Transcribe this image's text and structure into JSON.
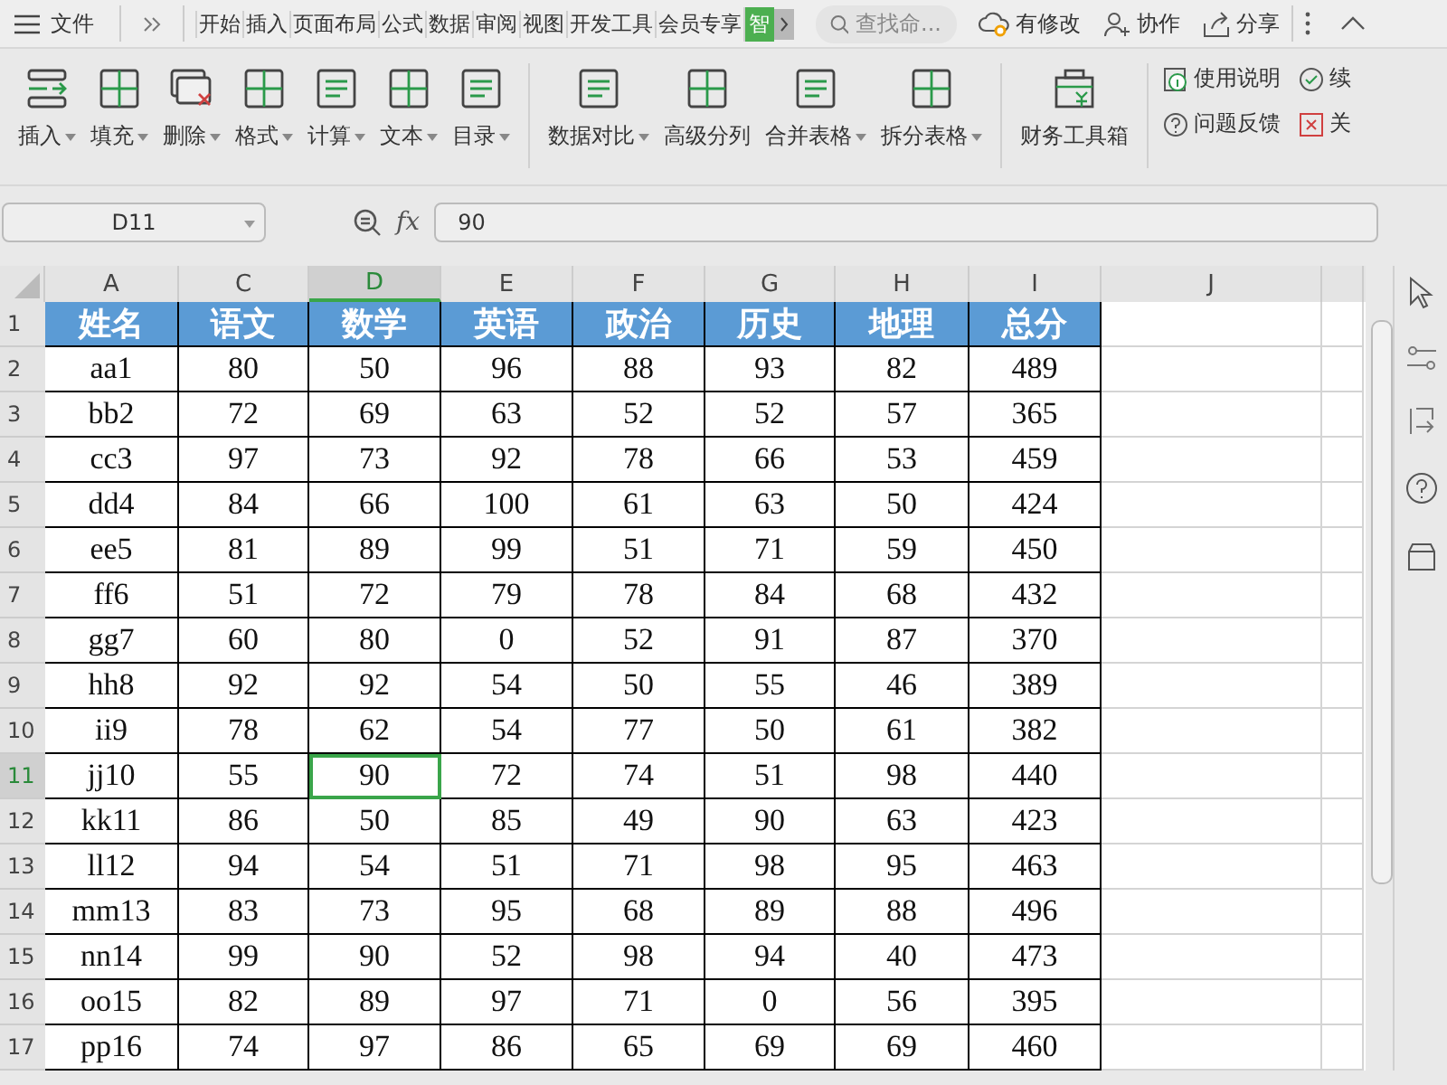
{
  "title_bar": {
    "file_menu": "文件",
    "tabs": [
      {
        "label": "开始",
        "selected": false
      },
      {
        "label": "插入",
        "selected": false
      },
      {
        "label": "页面布局",
        "selected": false
      },
      {
        "label": "公式",
        "selected": false
      },
      {
        "label": "数据",
        "selected": false
      },
      {
        "label": "审阅",
        "selected": false
      },
      {
        "label": "视图",
        "selected": false
      },
      {
        "label": "开发工具",
        "selected": false
      },
      {
        "label": "会员专享",
        "selected": false
      },
      {
        "label": "智",
        "selected": true
      }
    ],
    "search": {
      "placeholder": "查找命..."
    },
    "actions": [
      "有修改",
      "协作",
      "分享"
    ]
  },
  "ribbon": {
    "groups": [
      [
        {
          "label": "插入",
          "has_menu": true
        },
        {
          "label": "填充",
          "has_menu": true
        },
        {
          "label": "删除",
          "has_menu": true
        },
        {
          "label": "格式",
          "has_menu": true
        },
        {
          "label": "计算",
          "has_menu": true
        },
        {
          "label": "文本",
          "has_menu": true
        },
        {
          "label": "目录",
          "has_menu": true
        }
      ],
      [
        {
          "label": "数据对比",
          "has_menu": true
        },
        {
          "label": "高级分列",
          "has_menu": false
        },
        {
          "label": "合并表格",
          "has_menu": true
        },
        {
          "label": "拆分表格",
          "has_menu": true
        }
      ],
      [
        {
          "label": "财务工具箱",
          "has_menu": false
        }
      ]
    ],
    "side_links": [
      "使用说明",
      "续",
      "问题反馈",
      "关"
    ]
  },
  "formula_bar": {
    "name_box": "D11",
    "function_label": "fx",
    "value": "90"
  },
  "sheet": {
    "columns": [
      {
        "label": "A",
        "selected": false
      },
      {
        "label": "C",
        "selected": false
      },
      {
        "label": "D",
        "selected": true
      },
      {
        "label": "E",
        "selected": false
      },
      {
        "label": "F",
        "selected": false
      },
      {
        "label": "G",
        "selected": false
      },
      {
        "label": "H",
        "selected": false
      },
      {
        "label": "I",
        "selected": false
      },
      {
        "label": "J",
        "selected": false
      }
    ],
    "rows": [
      {
        "number": "1",
        "selected": false,
        "cells": [
          "姓名",
          "语文",
          "数学",
          "英语",
          "政治",
          "历史",
          "地理",
          "总分"
        ]
      },
      {
        "number": "2",
        "selected": false,
        "cells": [
          "aa1",
          "80",
          "50",
          "96",
          "88",
          "93",
          "82",
          "489"
        ]
      },
      {
        "number": "3",
        "selected": false,
        "cells": [
          "bb2",
          "72",
          "69",
          "63",
          "52",
          "52",
          "57",
          "365"
        ]
      },
      {
        "number": "4",
        "selected": false,
        "cells": [
          "cc3",
          "97",
          "73",
          "92",
          "78",
          "66",
          "53",
          "459"
        ]
      },
      {
        "number": "5",
        "selected": false,
        "cells": [
          "dd4",
          "84",
          "66",
          "100",
          "61",
          "63",
          "50",
          "424"
        ]
      },
      {
        "number": "6",
        "selected": false,
        "cells": [
          "ee5",
          "81",
          "89",
          "99",
          "51",
          "71",
          "59",
          "450"
        ]
      },
      {
        "number": "7",
        "selected": false,
        "cells": [
          "ff6",
          "51",
          "72",
          "79",
          "78",
          "84",
          "68",
          "432"
        ]
      },
      {
        "number": "8",
        "selected": false,
        "cells": [
          "gg7",
          "60",
          "80",
          "0",
          "52",
          "91",
          "87",
          "370"
        ]
      },
      {
        "number": "9",
        "selected": false,
        "cells": [
          "hh8",
          "92",
          "92",
          "54",
          "50",
          "55",
          "46",
          "389"
        ]
      },
      {
        "number": "10",
        "selected": false,
        "cells": [
          "ii9",
          "78",
          "62",
          "54",
          "77",
          "50",
          "61",
          "382"
        ]
      },
      {
        "number": "11",
        "selected": true,
        "cells": [
          "jj10",
          "55",
          "90",
          "72",
          "74",
          "51",
          "98",
          "440"
        ]
      },
      {
        "number": "12",
        "selected": false,
        "cells": [
          "kk11",
          "86",
          "50",
          "85",
          "49",
          "90",
          "63",
          "423"
        ]
      },
      {
        "number": "13",
        "selected": false,
        "cells": [
          "ll12",
          "94",
          "54",
          "51",
          "71",
          "98",
          "95",
          "463"
        ]
      },
      {
        "number": "14",
        "selected": false,
        "cells": [
          "mm13",
          "83",
          "73",
          "95",
          "68",
          "89",
          "88",
          "496"
        ]
      },
      {
        "number": "15",
        "selected": false,
        "cells": [
          "nn14",
          "99",
          "90",
          "52",
          "98",
          "94",
          "40",
          "473"
        ]
      },
      {
        "number": "16",
        "selected": false,
        "cells": [
          "oo15",
          "82",
          "89",
          "97",
          "71",
          "0",
          "56",
          "395"
        ]
      },
      {
        "number": "17",
        "selected": false,
        "cells": [
          "pp16",
          "74",
          "97",
          "86",
          "65",
          "69",
          "69",
          "460"
        ]
      }
    ]
  }
}
